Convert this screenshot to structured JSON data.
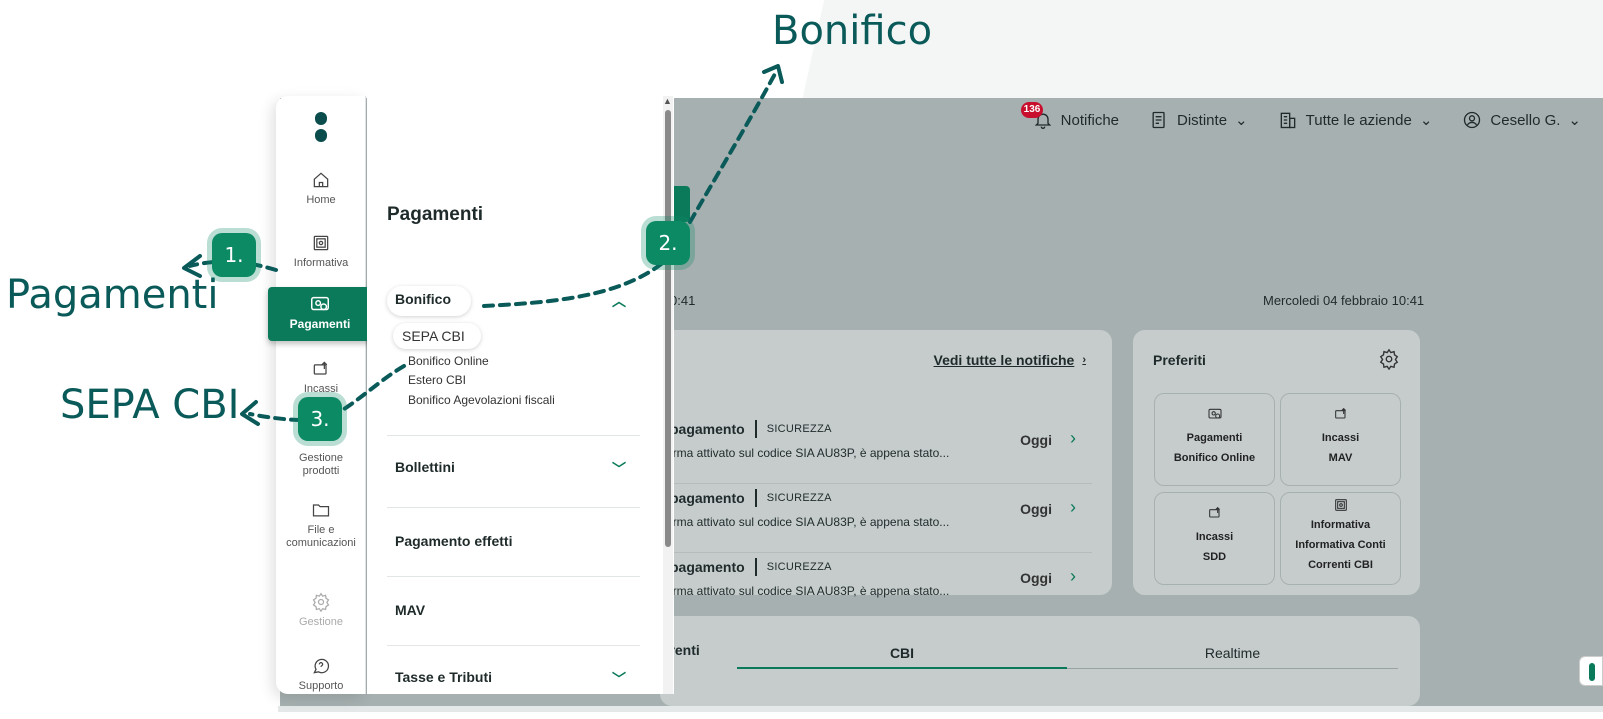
{
  "annotations": {
    "bonifico_label": "Bonifico",
    "pagamenti_label": "Pagamenti",
    "sepa_label": "SEPA CBI",
    "step1": "1.",
    "step2": "2.",
    "step3": "3."
  },
  "topbar": {
    "notifications_count": "136",
    "notifications_label": "Notifiche",
    "distinte_label": "Distinte",
    "companies_label": "Tutte le aziende",
    "user_label": "Cesello G."
  },
  "dashboard": {
    "time_left": "0:41",
    "date_right": "Mercoledi 04 febbraio 10:41",
    "see_all_notifications": "Vedi tutte le notifiche",
    "notifications": [
      {
        "title": "pagamento",
        "tag": "SICUREZZA",
        "desc": "irma attivato sul codice SIA AU83P, è appena stato...",
        "when": "Oggi"
      },
      {
        "title": "pagamento",
        "tag": "SICUREZZA",
        "desc": "irma attivato sul codice SIA AU83P, è appena stato...",
        "when": "Oggi"
      },
      {
        "title": "pagamento",
        "tag": "SICUREZZA",
        "desc": "irma attivato sul codice SIA AU83P, è appena stato...",
        "when": "Oggi"
      }
    ],
    "favorites_title": "Preferiti",
    "favorites": [
      {
        "line1": "Pagamenti",
        "line2": "Bonifico Online",
        "icon": "payment-icon"
      },
      {
        "line1": "Incassi",
        "line2": "MAV",
        "icon": "wallet-icon"
      },
      {
        "line1": "Incassi",
        "line2": "SDD",
        "icon": "wallet-icon"
      },
      {
        "line1": "Informativa",
        "line2": "Informativa Conti",
        "line3": "Correnti CBI",
        "icon": "safe-icon"
      }
    ],
    "accounts_title": "rrenti",
    "tab_cbi": "CBI",
    "tab_realtime": "Realtime"
  },
  "sidebar": {
    "items": [
      {
        "label": "Home",
        "icon": "home-icon"
      },
      {
        "label": "Informativa",
        "icon": "safe-icon"
      },
      {
        "label": "Pagamenti",
        "icon": "payment-icon"
      },
      {
        "label": "Incassi",
        "icon": "wallet-icon"
      },
      {
        "label": "Gestione prodotti",
        "icon": "box-icon"
      },
      {
        "label": "File e comunicazioni",
        "icon": "folder-icon"
      },
      {
        "label": "Gestione",
        "icon": "gear-icon"
      },
      {
        "label": "Supporto",
        "icon": "help-icon"
      }
    ]
  },
  "panel": {
    "title": "Pagamenti",
    "bonifico": "Bonifico",
    "sepa_cbi": "SEPA CBI",
    "sub_items": [
      "Bonifico Online",
      "Estero CBI",
      "Bonifico Agevolazioni fiscali"
    ],
    "bollettini": "Bollettini",
    "pagamento_effetti": "Pagamento effetti",
    "mav": "MAV",
    "tasse_tributi": "Tasse e Tributi"
  },
  "colors": {
    "brand": "#0b7a5a",
    "annotation": "#0b5a5a"
  }
}
